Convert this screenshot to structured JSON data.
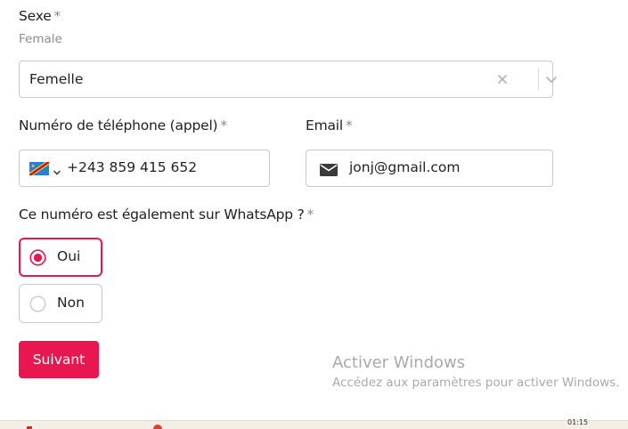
{
  "form": {
    "sexe": {
      "label": "Sexe",
      "required_mark": "*",
      "hint": "Female",
      "value": "Femelle"
    },
    "phone": {
      "label": "Numéro de téléphone (appel)",
      "required_mark": "*",
      "country_flag": "drc-flag-icon",
      "value": "+243 859 415 652"
    },
    "email": {
      "label": "Email",
      "required_mark": "*",
      "icon": "envelope-icon",
      "value": "jonj@gmail.com"
    },
    "whatsapp": {
      "question": "Ce numéro est également sur WhatsApp ?",
      "required_mark": "*",
      "options": [
        {
          "label": "Oui",
          "selected": true
        },
        {
          "label": "Non",
          "selected": false
        }
      ]
    },
    "next_button": "Suivant"
  },
  "watermark": {
    "title": "Activer Windows",
    "subtitle": "Accédez aux paramètres pour activer Windows."
  },
  "taskbar": {
    "clock": "01:15"
  },
  "colors": {
    "accent": "#e8174f",
    "border": "#c9c9c9",
    "muted_text": "#8c8c8c"
  }
}
